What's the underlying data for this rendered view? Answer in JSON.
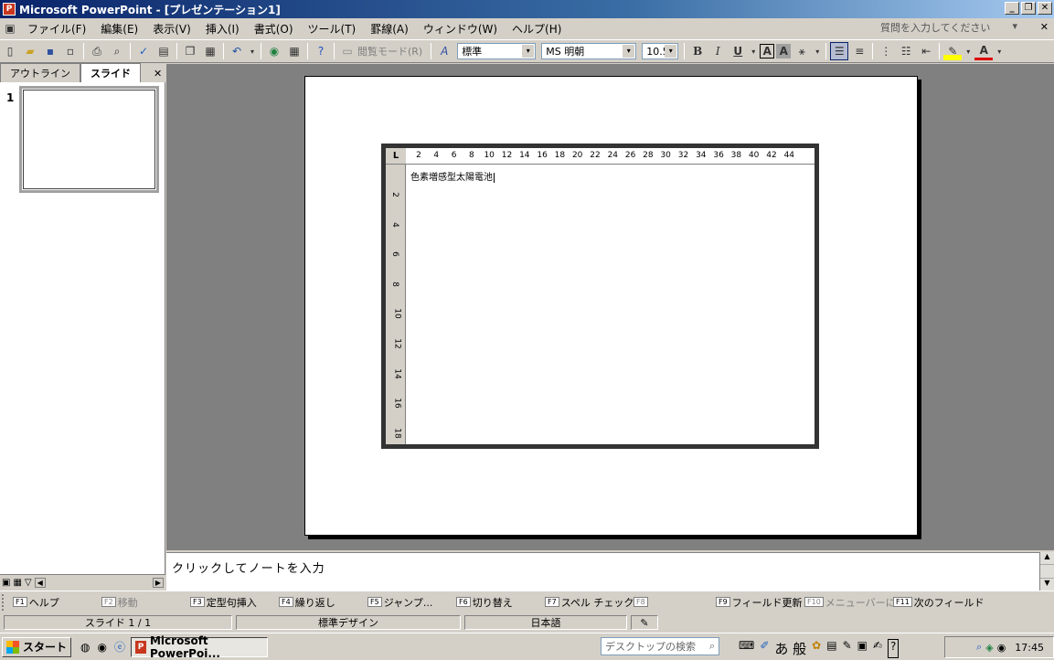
{
  "titlebar": {
    "title": "Microsoft PowerPoint - [プレゼンテーション1]",
    "min": "_",
    "restore": "❐",
    "close": "✕"
  },
  "menu": {
    "items": [
      "ファイル(F)",
      "編集(E)",
      "表示(V)",
      "挿入(I)",
      "書式(O)",
      "ツール(T)",
      "罫線(A)",
      "ウィンドウ(W)",
      "ヘルプ(H)"
    ],
    "help_placeholder": "質問を入力してください",
    "help_arrow": "▾"
  },
  "toolbar": {
    "reading_mode": "閲覧モード(R)",
    "style": "標準",
    "font": "MS 明朝",
    "size": "10.5",
    "bold": "B",
    "italic": "I",
    "underline": "U",
    "char_box": "A",
    "char_shade": "A",
    "font_color": "A"
  },
  "tabs": {
    "outline": "アウトライン",
    "slide": "スライド",
    "close": "✕"
  },
  "thumbnail": {
    "number": "1"
  },
  "ruler": {
    "h_ticks": [
      "2",
      "4",
      "6",
      "8",
      "10",
      "12",
      "14",
      "16",
      "18",
      "20",
      "22",
      "24",
      "26",
      "28",
      "30",
      "32",
      "34",
      "36",
      "38",
      "40",
      "42",
      "44"
    ],
    "v_ticks": [
      "2",
      "4",
      "6",
      "8",
      "10",
      "12",
      "14",
      "16",
      "18"
    ],
    "corner": "L"
  },
  "doc": {
    "text": "色素増感型太陽電池"
  },
  "notes": {
    "placeholder": "クリックしてノートを入力"
  },
  "fkeys": [
    {
      "key": "F1",
      "label": "ヘルプ",
      "dim": false
    },
    {
      "key": "F2",
      "label": "移動",
      "dim": true
    },
    {
      "key": "F3",
      "label": "定型句挿入",
      "dim": false
    },
    {
      "key": "F4",
      "label": "繰り返し",
      "dim": false
    },
    {
      "key": "F5",
      "label": "ジャンプ...",
      "dim": false
    },
    {
      "key": "F6",
      "label": "切り替え",
      "dim": false
    },
    {
      "key": "F7",
      "label": "スペル チェック...",
      "dim": false
    },
    {
      "key": "F8",
      "label": "",
      "dim": true
    },
    {
      "key": "F9",
      "label": "フィールド更新",
      "dim": false
    },
    {
      "key": "F10",
      "label": "メニューバーに",
      "dim": true
    },
    {
      "key": "F11",
      "label": "次のフィールド",
      "dim": false
    }
  ],
  "status": {
    "slide": "スライド 1 / 1",
    "design": "標準デザイン",
    "language": "日本語"
  },
  "taskbar": {
    "start": "スタート",
    "app": "Microsoft PowerPoi...",
    "search_placeholder": "デスクトップの検索",
    "clock": "17:45",
    "ime": "あ 般"
  },
  "colors": {
    "title_start": "#0a246a",
    "title_end": "#a6caf0",
    "face": "#d4d0c8",
    "canvas": "#808080"
  }
}
